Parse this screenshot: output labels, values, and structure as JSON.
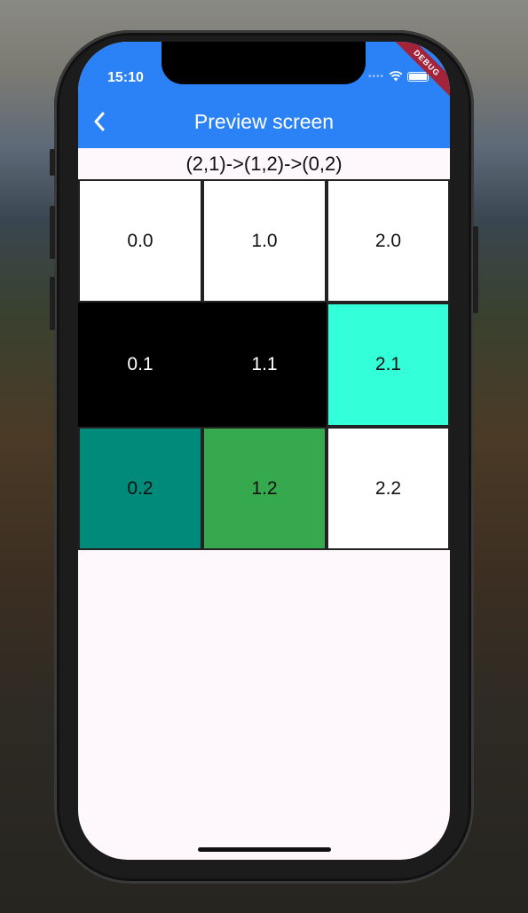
{
  "status_bar": {
    "time": "15:10",
    "debug_label": "DEBUG"
  },
  "app_bar": {
    "title": "Preview screen",
    "back_icon": "chevron-left-icon"
  },
  "path_text": "(2,1)->(1,2)->(0,2)",
  "grid": {
    "cells": [
      {
        "label": "0.0",
        "color": "#ffffff",
        "text_color": "#111111"
      },
      {
        "label": "1.0",
        "color": "#ffffff",
        "text_color": "#111111"
      },
      {
        "label": "2.0",
        "color": "#ffffff",
        "text_color": "#111111"
      },
      {
        "label": "0.1",
        "color": "#000000",
        "text_color": "#ffffff"
      },
      {
        "label": "1.1",
        "color": "#000000",
        "text_color": "#ffffff"
      },
      {
        "label": "2.1",
        "color": "#33ffd8",
        "text_color": "#111111"
      },
      {
        "label": "0.2",
        "color": "#008a7a",
        "text_color": "#111111"
      },
      {
        "label": "1.2",
        "color": "#36a84d",
        "text_color": "#111111"
      },
      {
        "label": "2.2",
        "color": "#ffffff",
        "text_color": "#111111"
      }
    ]
  },
  "colors": {
    "app_bar": "#2b82f6",
    "background": "#fef7fb",
    "debug_banner": "#a3233a"
  }
}
